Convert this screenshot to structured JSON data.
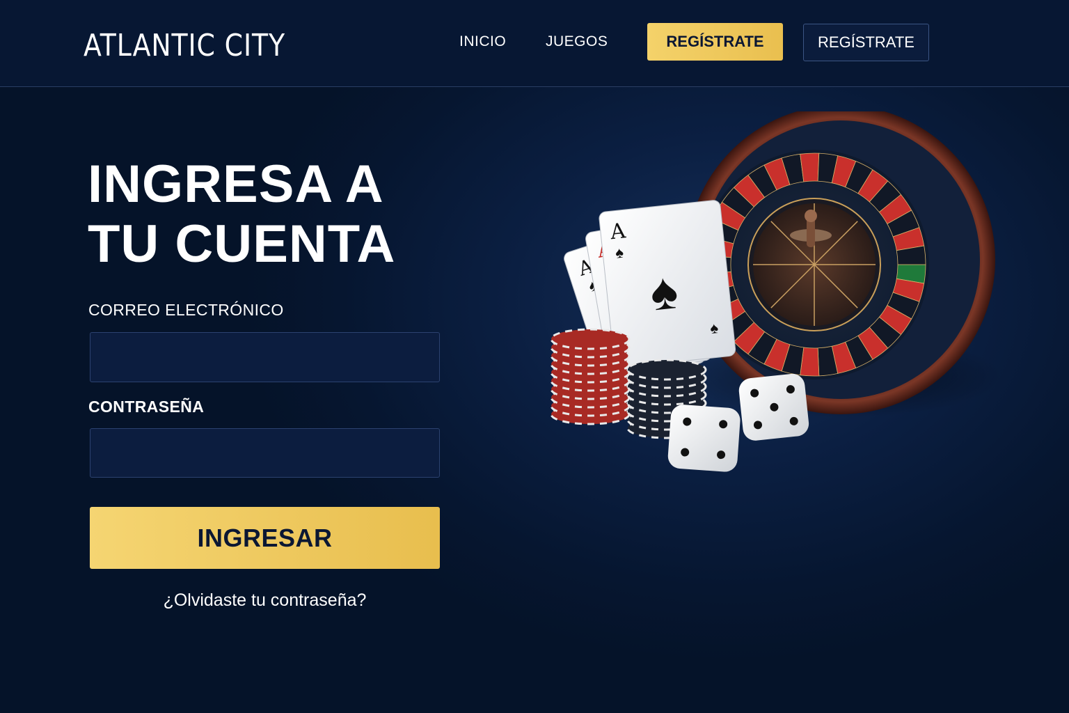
{
  "header": {
    "logo": "ATLANTIC CITY",
    "nav": {
      "inicio": "INICIO",
      "juegos": "JUEGOS"
    },
    "register_primary": "REGÍSTRATE",
    "register_secondary": "REGÍSTRATE"
  },
  "login": {
    "title_line1": "INGRESA A",
    "title_line2": "TU CUENTA",
    "email_label": "CORREO ELECTRÓNICO",
    "email_value": "",
    "password_label": "CONTRASEÑA",
    "password_value": "",
    "submit_label": "INGRESAR",
    "forgot_label": "¿Olvidaste tu contraseña?"
  },
  "illustration": {
    "icons": [
      "roulette-wheel-icon",
      "playing-cards-icon",
      "poker-chips-icon",
      "dice-icon"
    ],
    "card_rank": "A"
  },
  "colors": {
    "background": "#061630",
    "gold": "#f0c95c",
    "input_bg": "#0c1d3f",
    "roulette_red": "#c9302c",
    "roulette_rim": "#6b2e22"
  }
}
